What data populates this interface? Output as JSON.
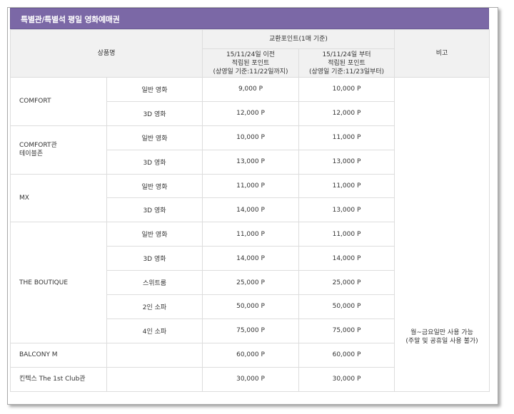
{
  "title": "특별관/특별석 평일 영화예매권",
  "header": {
    "product": "상품명",
    "exchange_points": "교환포인트(1매 기준)",
    "before": [
      "15/11/24일 이전",
      "적립된 포인트",
      "(상영일 기준:11/22일까지)"
    ],
    "after": [
      "15/11/24일 부터",
      "적립된 포인트",
      "(상영일 기준:11/23일부터)"
    ],
    "remarks": "비고"
  },
  "products": [
    {
      "name": [
        "COMFORT"
      ],
      "rows": [
        {
          "type": "일반 영화",
          "before": "9,000 P",
          "after": "10,000 P"
        },
        {
          "type": "3D 영화",
          "before": "12,000 P",
          "after": "12,000 P"
        }
      ]
    },
    {
      "name": [
        "COMFORT관",
        "테이블존"
      ],
      "rows": [
        {
          "type": "일반 영화",
          "before": "10,000 P",
          "after": "11,000 P"
        },
        {
          "type": "3D 영화",
          "before": "13,000 P",
          "after": "13,000 P"
        }
      ]
    },
    {
      "name": [
        "MX"
      ],
      "rows": [
        {
          "type": "일반 영화",
          "before": "11,000 P",
          "after": "11,000 P"
        },
        {
          "type": "3D 영화",
          "before": "14,000 P",
          "after": "13,000 P"
        }
      ]
    },
    {
      "name": [
        "THE BOUTIQUE"
      ],
      "rows": [
        {
          "type": "일반 영화",
          "before": "11,000 P",
          "after": "11,000 P"
        },
        {
          "type": "3D 영화",
          "before": "14,000 P",
          "after": "14,000 P"
        },
        {
          "type": "스위트룸",
          "before": "25,000 P",
          "after": "25,000 P"
        },
        {
          "type": "2인 소파",
          "before": "50,000 P",
          "after": "50,000 P"
        },
        {
          "type": "4인 소파",
          "before": "75,000 P",
          "after": "75,000 P"
        }
      ]
    },
    {
      "name": [
        "BALCONY M"
      ],
      "rows": [
        {
          "type": "",
          "before": "60,000 P",
          "after": "60,000 P"
        }
      ]
    },
    {
      "name": [
        "킨텍스 The 1st Club관"
      ],
      "rows": [
        {
          "type": "",
          "before": "30,000 P",
          "after": "30,000 P"
        }
      ]
    }
  ],
  "note": [
    "월~금요일만 사용 가능",
    "(주말 및 공휴일 사용 불가)"
  ],
  "colors": {
    "title_bar": "#7b68a6",
    "header_bg": "#f1f1f1",
    "border": "#dddddd"
  }
}
